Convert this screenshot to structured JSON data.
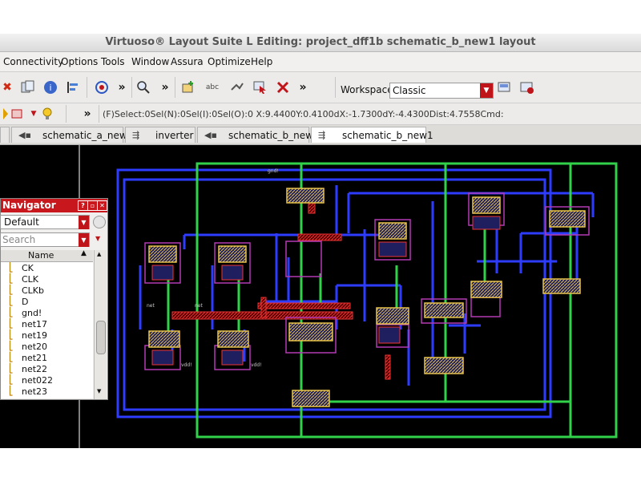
{
  "window": {
    "title": "Virtuoso® Layout Suite L Editing: project_dff1b schematic_b_new1 layout"
  },
  "menu": [
    "Connectivity",
    "Options",
    "Tools",
    "Window",
    "Assura",
    "Optimize",
    "Help"
  ],
  "toolbar": {
    "overflow_1": "»",
    "overflow_2": "»",
    "overflow_3": "»",
    "abc_label": "abc",
    "workspace_label": "Workspace:",
    "workspace_value": "Classic"
  },
  "status_line": "(F)Select:0Sel(N):0Sel(I):0Sel(O):0 X:9.4400Y:0.4100dX:-1.7300dY:-4.4300Dist:4.7558Cmd:",
  "tabs": [
    {
      "label": "schematic_a_new",
      "active": false
    },
    {
      "label": "inverter",
      "active": false
    },
    {
      "label": "schematic_b_new",
      "active": false
    },
    {
      "label": "schematic_b_new1",
      "active": true
    }
  ],
  "navigator": {
    "title": "Navigator",
    "filter_value": "Default",
    "search_placeholder": "Search",
    "column_header": "Name",
    "nets": [
      "CK",
      "CLK",
      "CLKb",
      "D",
      "gnd!",
      "net17",
      "net19",
      "net20",
      "net21",
      "net22",
      "net022",
      "net23"
    ]
  },
  "colors": {
    "accent_red": "#c0141b",
    "canvas_bg": "#000000",
    "metal_blue": "#2d3cff",
    "poly_green": "#31d24a",
    "contact_red": "#d42a2a"
  }
}
